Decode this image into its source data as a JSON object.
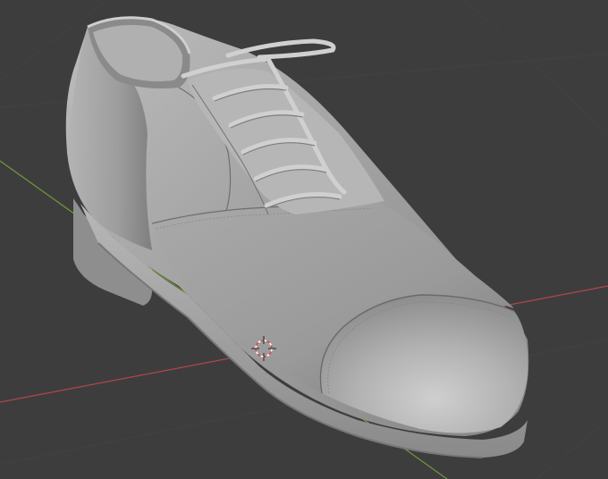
{
  "viewport": {
    "background": "#3d3d3d",
    "grid_color": "#434343",
    "axis_x_color": "#b3464b",
    "axis_y_color": "#6f9a3a",
    "cursor_colors": [
      "#d24a4a",
      "#ffffff"
    ]
  },
  "model": {
    "object": "shoe",
    "style": "cap-toe oxford",
    "shading": "solid",
    "base_color": "#9c9c9c",
    "highlight_color": "#c6c6c6",
    "shadow_color": "#6a6a6a",
    "eyelet_pairs": 5
  },
  "icons": [
    "3d-cursor-icon"
  ]
}
